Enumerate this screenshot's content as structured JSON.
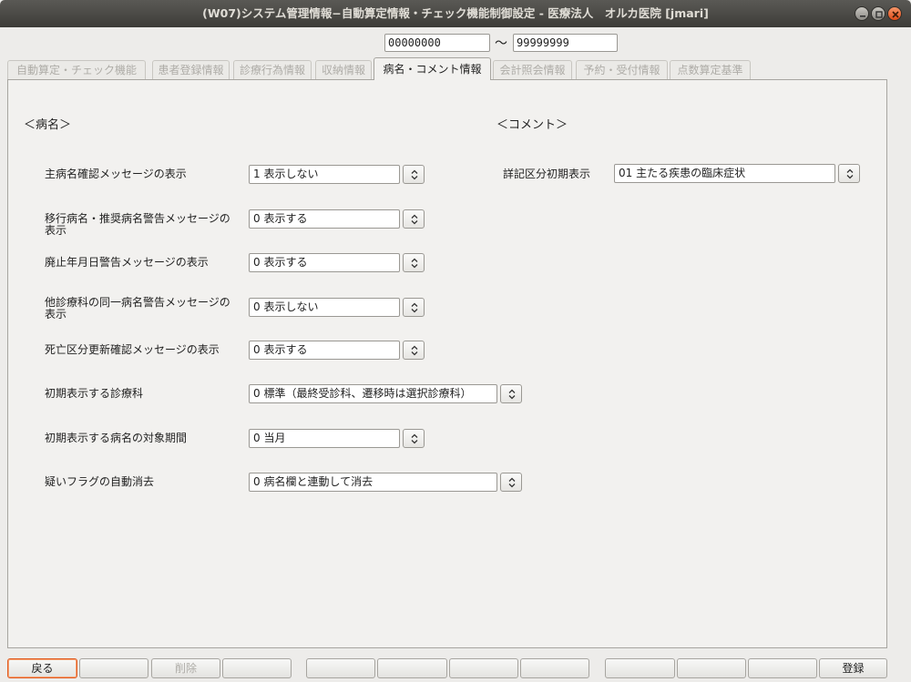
{
  "window": {
    "title": "(W07)システム管理情報−自動算定情報・チェック機能制御設定 - 医療法人　オルカ医院 [jmari]"
  },
  "range": {
    "from": "00000000",
    "separator": "〜",
    "to": "99999999"
  },
  "tabs": [
    {
      "label": "自動算定・チェック機能",
      "active": false
    },
    {
      "label": "患者登録情報",
      "active": false
    },
    {
      "label": "診療行為情報",
      "active": false
    },
    {
      "label": "収納情報",
      "active": false
    },
    {
      "label": "病名・コメント情報",
      "active": true
    },
    {
      "label": "会計照会情報",
      "active": false
    },
    {
      "label": "予約・受付情報",
      "active": false
    },
    {
      "label": "点数算定基準",
      "active": false
    }
  ],
  "disease": {
    "heading": "＜病名＞",
    "settings": [
      {
        "label": "主病名確認メッセージの表示",
        "value": "1 表示しない"
      },
      {
        "label": "移行病名・推奨病名警告メッセージの表示",
        "value": "0 表示する"
      },
      {
        "label": "廃止年月日警告メッセージの表示",
        "value": "0 表示する"
      },
      {
        "label": "他診療科の同一病名警告メッセージの表示",
        "value": "0 表示しない"
      },
      {
        "label": "死亡区分更新確認メッセージの表示",
        "value": "0 表示する"
      },
      {
        "label": "初期表示する診療科",
        "value": "0 標準（最終受診科、遷移時は選択診療科）"
      },
      {
        "label": "初期表示する病名の対象期間",
        "value": "0 当月"
      },
      {
        "label": "疑いフラグの自動消去",
        "value": "0 病名欄と連動して消去"
      }
    ]
  },
  "comment": {
    "heading": "＜コメント＞",
    "label": "詳記区分初期表示",
    "value": "01 主たる疾患の臨床症状"
  },
  "footer": {
    "buttons": [
      "戻る",
      "",
      "削除",
      "",
      "",
      "",
      "",
      "",
      "",
      "",
      "",
      "登録"
    ]
  }
}
